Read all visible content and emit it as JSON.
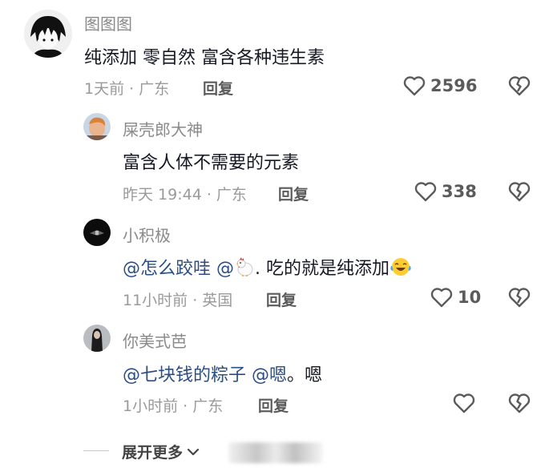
{
  "comments": [
    {
      "user": "图图图",
      "text": "纯添加 零自然 富含各种违生素",
      "time": "1天前 · 广东",
      "reply": "回复",
      "likes": "2596"
    },
    {
      "user": "屎壳郎大神",
      "text": "富含人体不需要的元素",
      "time": "昨天 19:44 · 广东",
      "reply": "回复",
      "likes": "338"
    },
    {
      "user": "小积极",
      "mention1": "@怎么跤哇",
      "mention2": "@",
      "text_after": ". 吃的就是纯添加",
      "time": "11小时前 · 英国",
      "reply": "回复",
      "likes": "10"
    },
    {
      "user": "你美式芭",
      "mention1": "@七块钱的粽子",
      "mention2": "@嗯",
      "text_after": "。嗯",
      "time": "1小时前 · 广东",
      "reply": "回复",
      "likes": ""
    }
  ],
  "expand_more": "展开更多"
}
